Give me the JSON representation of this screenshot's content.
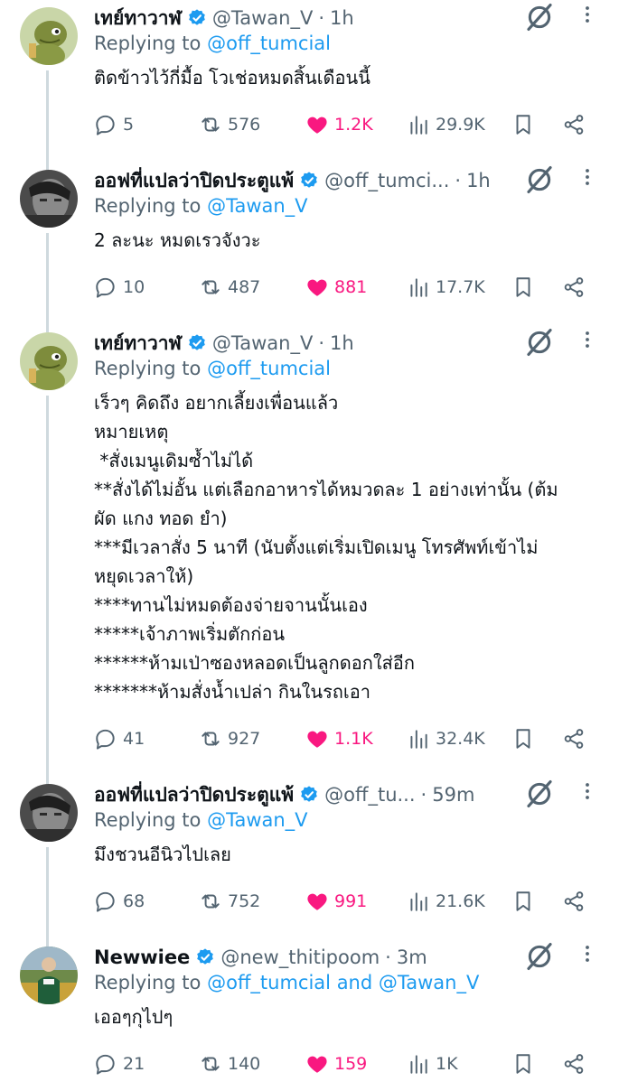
{
  "tweets": [
    {
      "name": "เทย์ทาวาฬ",
      "handle": "@Tawan_V",
      "dot": "·",
      "time": "1h",
      "replying_label": "Replying to",
      "replying_to": "@off_tumcial",
      "replying_and": "",
      "replying_to2": "",
      "body": [
        "ติดข้าวไว้กี่มื้อ โวเช่อหมดสิ้นเดือนนี้"
      ],
      "replies": "5",
      "reposts": "576",
      "likes": "1.2K",
      "views": "29.9K",
      "avatar": "cartoon-dinosaur"
    },
    {
      "name": "ออฟที่แปลว่าปิดประตูแพ้",
      "handle": "@off_tumci...",
      "dot": "·",
      "time": "1h",
      "replying_label": "Replying to",
      "replying_to": "@Tawan_V",
      "replying_and": "",
      "replying_to2": "",
      "body": [
        "2 ละนะ หมดเรวจังวะ"
      ],
      "replies": "10",
      "reposts": "487",
      "likes": "881",
      "views": "17.7K",
      "avatar": "grayscale-portrait"
    },
    {
      "name": "เทย์ทาวาฬ",
      "handle": "@Tawan_V",
      "dot": "·",
      "time": "1h",
      "replying_label": "Replying to",
      "replying_to": "@off_tumcial",
      "replying_and": "",
      "replying_to2": "",
      "body": [
        "เร็วๆ คิดถึง อยากเลี้ยงเพื่อนแล้ว",
        "หมายเหตุ",
        " *สั่งเมนูเดิมซ้ำไม่ได้",
        "**สั่งได้ไม่อั้น แต่เลือกอาหารได้หมวดละ 1 อย่างเท่านั้น (ต้ม",
        "ผัด แกง ทอด ยำ)",
        "***มีเวลาสั่ง 5 นาที (นับตั้งแต่เริ่มเปิดเมนู โทรศัพท์เข้าไม่",
        "หยุดเวลาให้)",
        "****ทานไม่หมดต้องจ่ายจานนั้นเอง",
        "*****เจ้าภาพเริ่มตักก่อน",
        "******ห้ามเป่าซองหลอดเป็นลูกดอกใส่อีก",
        "*******ห้ามสั่งน้ำเปล่า กินในรถเอา"
      ],
      "replies": "41",
      "reposts": "927",
      "likes": "1.1K",
      "views": "32.4K",
      "avatar": "cartoon-dinosaur"
    },
    {
      "name": "ออฟที่แปลว่าปิดประตูแพ้",
      "handle": "@off_tu...",
      "dot": "·",
      "time": "59m",
      "replying_label": "Replying to",
      "replying_to": "@Tawan_V",
      "replying_and": "",
      "replying_to2": "",
      "body": [
        "มึงชวนอีนิวไปเลย"
      ],
      "replies": "68",
      "reposts": "752",
      "likes": "991",
      "views": "21.6K",
      "avatar": "grayscale-portrait"
    },
    {
      "name": "Newwiee",
      "handle": "@new_thitipoom",
      "dot": "·",
      "time": "3m",
      "replying_label": "Replying to",
      "replying_to": "@off_tumcial",
      "replying_and": "and",
      "replying_to2": "@Tawan_V",
      "body": [
        "เออๆกุไปๆ"
      ],
      "replies": "21",
      "reposts": "140",
      "likes": "159",
      "views": "1K",
      "avatar": "outdoor-photo"
    }
  ],
  "icons": {
    "reply": "reply-icon",
    "repost": "repost-icon",
    "like": "heart-icon",
    "views": "views-icon",
    "bookmark": "bookmark-icon",
    "share": "share-icon",
    "grok": "grok-icon",
    "more": "more-vertical-icon",
    "verified": "verified-badge-icon"
  },
  "colors": {
    "text": "#0f1419",
    "muted": "#536471",
    "link": "#1d9bf0",
    "like": "#f91880",
    "verified": "#1d9bf0",
    "thread_line": "#cfd9de"
  }
}
